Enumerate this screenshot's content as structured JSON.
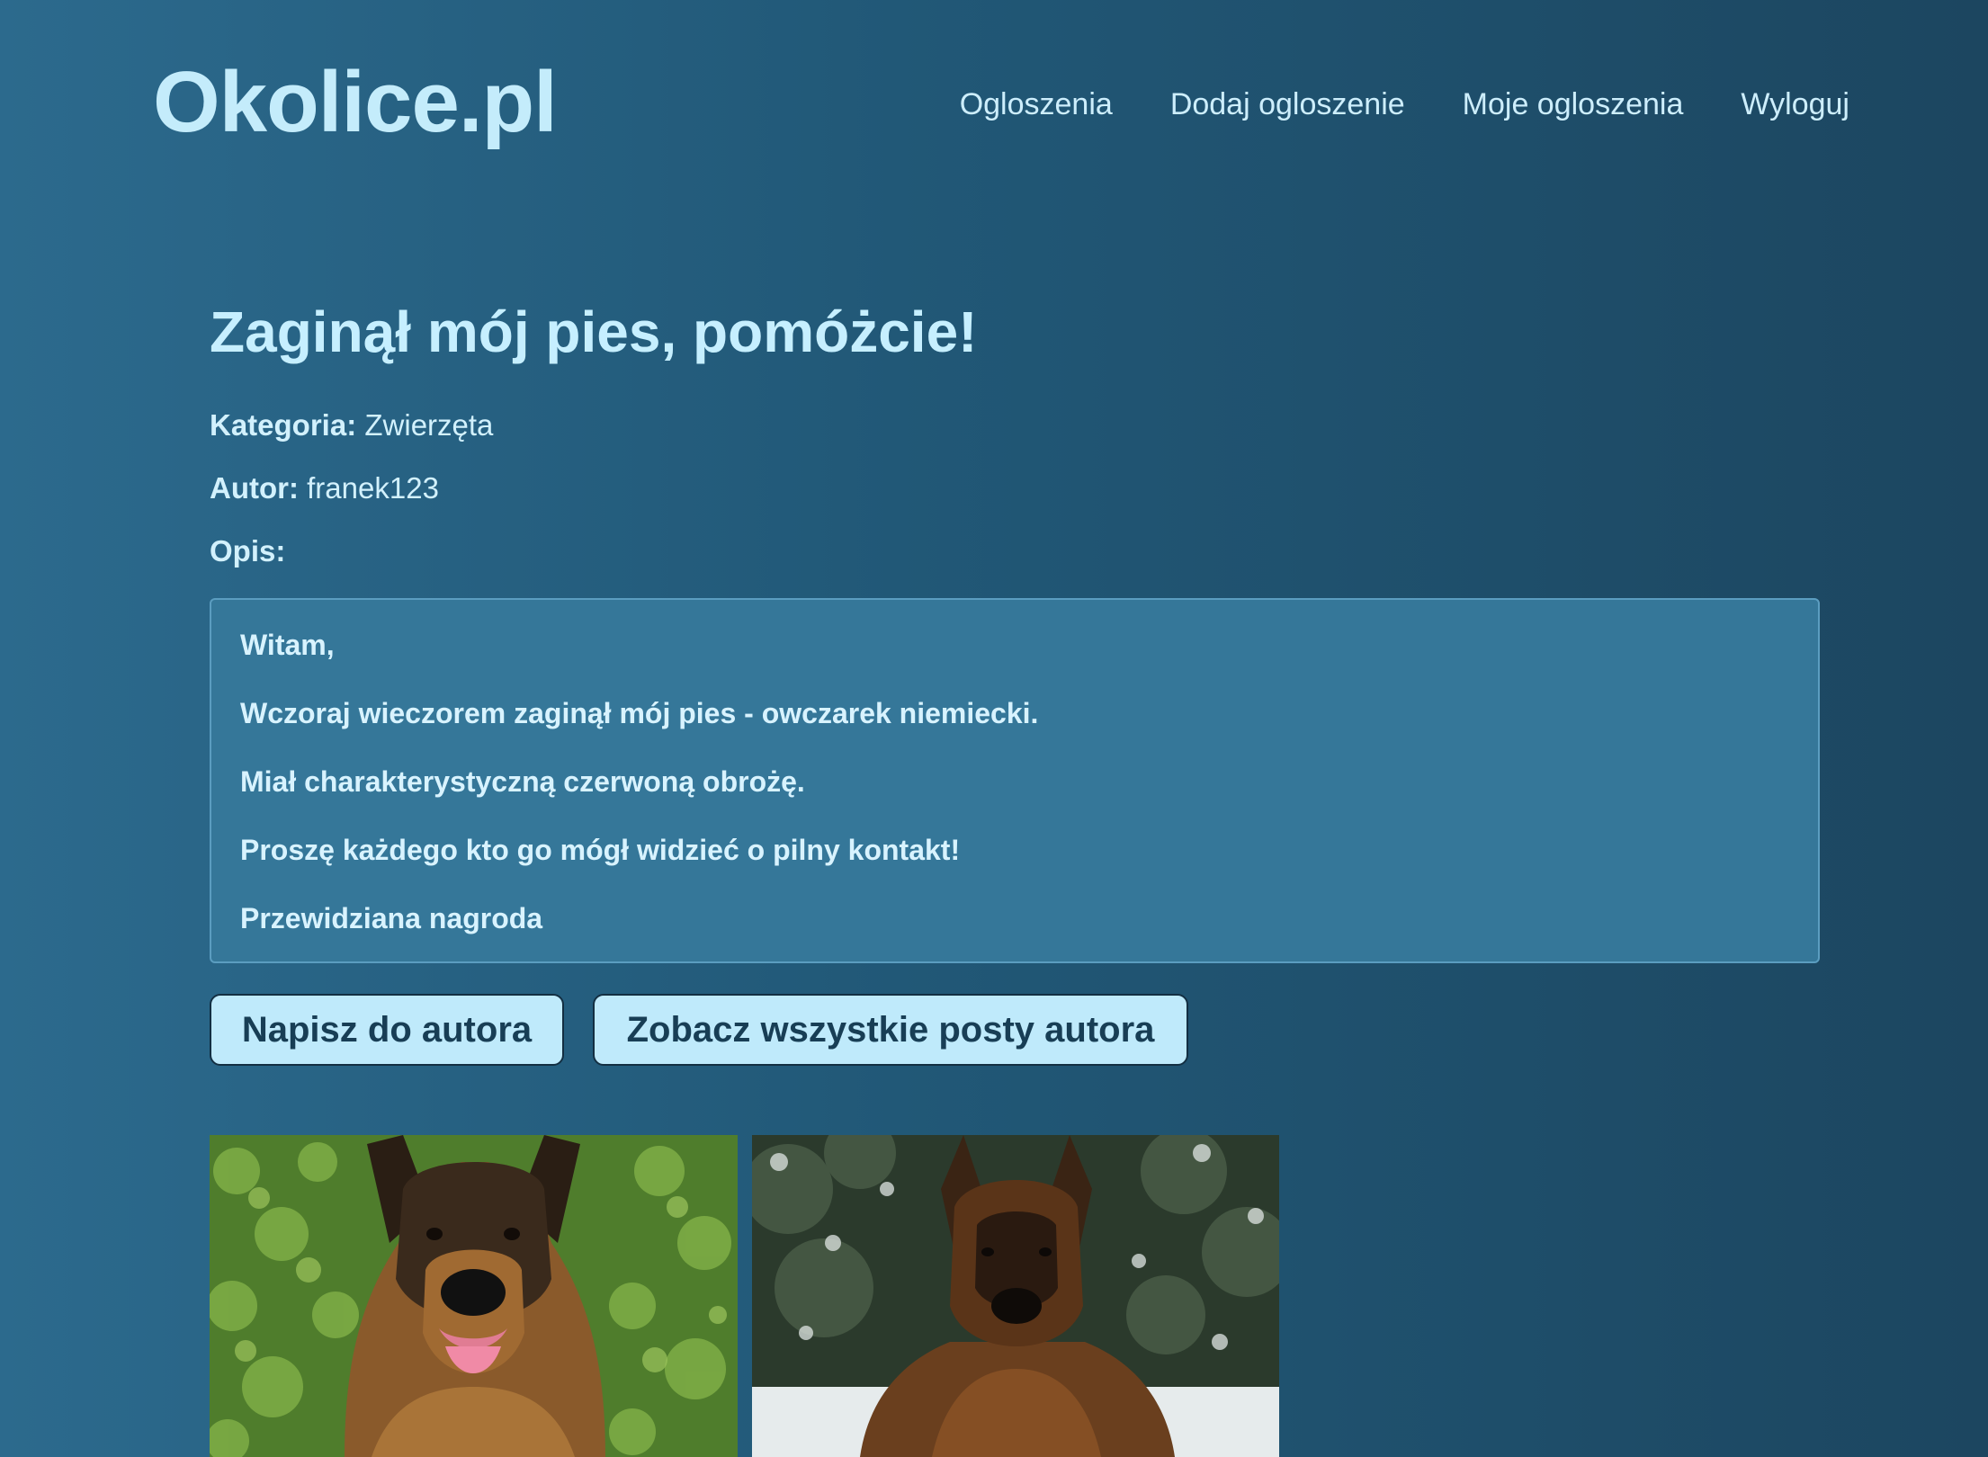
{
  "header": {
    "logo": "Okolice.pl",
    "nav": [
      "Ogloszenia",
      "Dodaj ogloszenie",
      "Moje ogloszenia",
      "Wyloguj"
    ]
  },
  "listing": {
    "title": "Zaginął mój pies, pomóżcie!",
    "category_label": "Kategoria:",
    "category_value": "Zwierzęta",
    "author_label": "Autor:",
    "author_value": "franek123",
    "description_label": "Opis:",
    "description_lines": [
      "Witam,",
      "Wczoraj wieczorem zaginął mój pies - owczarek niemiecki.",
      "Miał charakterystyczną czerwoną obrożę.",
      "Proszę każdego kto go mógł widzieć o pilny kontakt!",
      "Przewidziana nagroda"
    ]
  },
  "actions": {
    "write_to_author": "Napisz do autora",
    "see_all_posts": "Zobacz wszystkie posty autora"
  },
  "photos": [
    {
      "subject": "german-shepherd-photo",
      "background": "green-foliage"
    },
    {
      "subject": "german-shepherd-photo",
      "background": "snowy-forest"
    }
  ],
  "colors": {
    "background_left": "#2c6a8d",
    "background_right": "#1c4660",
    "logo": "#c4ecfb",
    "description_box": "#357799",
    "button_bg": "#bfeafb",
    "button_text": "#183e55"
  }
}
